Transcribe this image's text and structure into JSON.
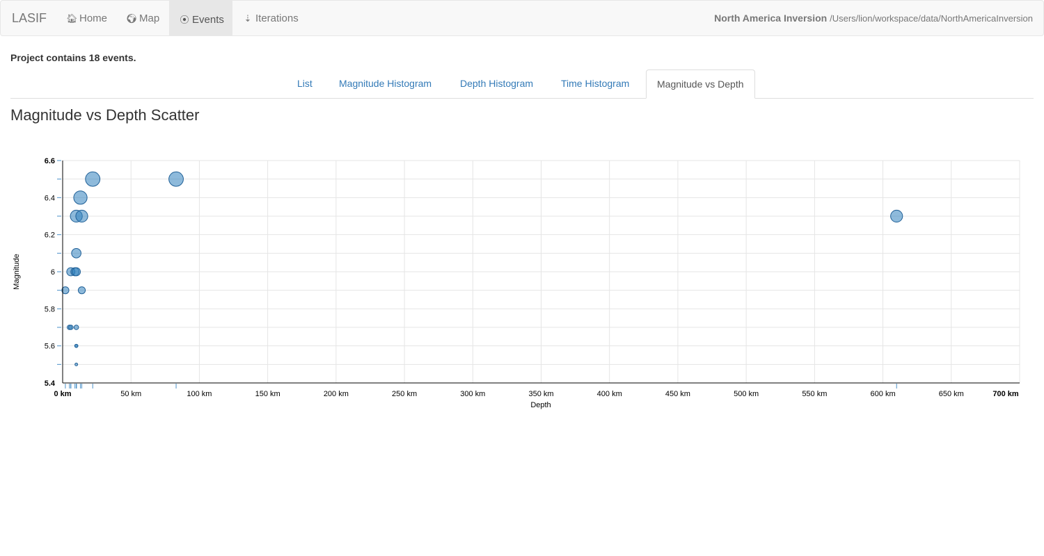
{
  "navbar": {
    "brand": "LASIF",
    "items": [
      {
        "label": "Home",
        "icon": "home-icon",
        "glyph": "🏠︎"
      },
      {
        "label": "Map",
        "icon": "globe-icon",
        "glyph": "🌍︎"
      },
      {
        "label": "Events",
        "icon": "record-icon",
        "glyph": "⦿"
      },
      {
        "label": "Iterations",
        "icon": "sort-icon",
        "glyph": "⇣"
      }
    ],
    "active_item": "Events",
    "project_name": "North America Inversion",
    "project_path": "/Users/lion/workspace/data/NorthAmericaInversion"
  },
  "summary": "Project contains 18 events.",
  "tabs": [
    {
      "label": "List"
    },
    {
      "label": "Magnitude Histogram"
    },
    {
      "label": "Depth Histogram"
    },
    {
      "label": "Time Histogram"
    },
    {
      "label": "Magnitude vs Depth"
    }
  ],
  "active_tab": "Magnitude vs Depth",
  "chart_title": "Magnitude vs Depth Scatter",
  "colors": {
    "dot": "#3182bd",
    "link": "#337ab7"
  },
  "chart_data": {
    "type": "scatter",
    "xlabel": "Depth",
    "ylabel": "Magnitude",
    "xlim": [
      0,
      700
    ],
    "ylim": [
      5.4,
      6.6
    ],
    "x_ticks": [
      "0 km",
      "50 km",
      "100 km",
      "150 km",
      "200 km",
      "250 km",
      "300 km",
      "350 km",
      "400 km",
      "450 km",
      "500 km",
      "550 km",
      "600 km",
      "650 km",
      "700 km"
    ],
    "y_ticks": [
      "5.4",
      "5.6",
      "5.8",
      "6",
      "6.2",
      "6.4",
      "6.6"
    ],
    "points": [
      {
        "depth": 22,
        "magnitude": 6.5
      },
      {
        "depth": 83,
        "magnitude": 6.5
      },
      {
        "depth": 13,
        "magnitude": 6.4
      },
      {
        "depth": 10,
        "magnitude": 6.3
      },
      {
        "depth": 14,
        "magnitude": 6.3
      },
      {
        "depth": 610,
        "magnitude": 6.3
      },
      {
        "depth": 10,
        "magnitude": 6.1
      },
      {
        "depth": 6,
        "magnitude": 6.0
      },
      {
        "depth": 9,
        "magnitude": 6.0
      },
      {
        "depth": 10,
        "magnitude": 6.0
      },
      {
        "depth": 2,
        "magnitude": 5.9
      },
      {
        "depth": 14,
        "magnitude": 5.9
      },
      {
        "depth": 5,
        "magnitude": 5.7
      },
      {
        "depth": 6,
        "magnitude": 5.7
      },
      {
        "depth": 10,
        "magnitude": 5.7
      },
      {
        "depth": 10,
        "magnitude": 5.6
      },
      {
        "depth": 10,
        "magnitude": 5.6
      },
      {
        "depth": 10,
        "magnitude": 5.5
      }
    ]
  }
}
